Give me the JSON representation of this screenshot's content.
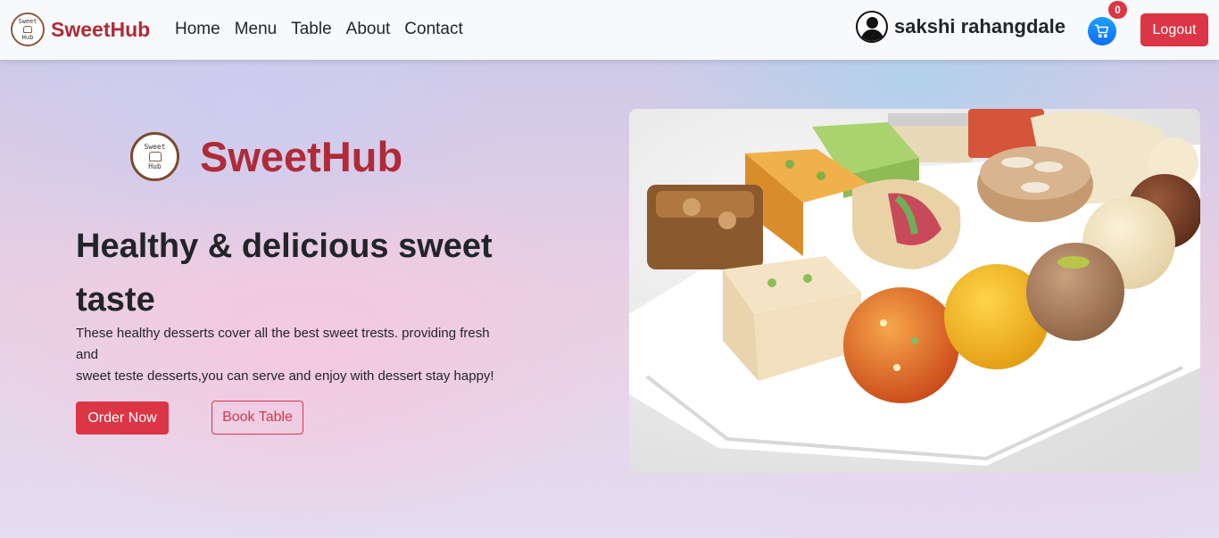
{
  "navbar": {
    "brand": "SweetHub",
    "logo_text_top": "Sweet",
    "logo_text_bottom": "Hub",
    "links": [
      "Home",
      "Menu",
      "Table",
      "About",
      "Contact"
    ],
    "user_name": "sakshi rahangdale",
    "cart_count": "0",
    "logout_label": "Logout"
  },
  "hero": {
    "brand": "SweetHub",
    "headline_line1": "Healthy & delicious sweet",
    "headline_line2": "taste",
    "desc_line1": "These healthy desserts cover all the best sweet trests. providing fresh",
    "desc_line2": "and",
    "desc_line3": "sweet teste desserts,you can serve and enjoy with dessert stay happy!",
    "order_label": "Order Now",
    "book_label": "Book Table"
  },
  "icons": {
    "cart": "cart-icon",
    "avatar": "user-avatar-icon",
    "logo": "sweethub-logo"
  },
  "colors": {
    "brand_red": "#b02a37",
    "button_red": "#dc3545",
    "cart_blue": "#0d6efd",
    "navbar_bg": "#f8f9fa"
  }
}
